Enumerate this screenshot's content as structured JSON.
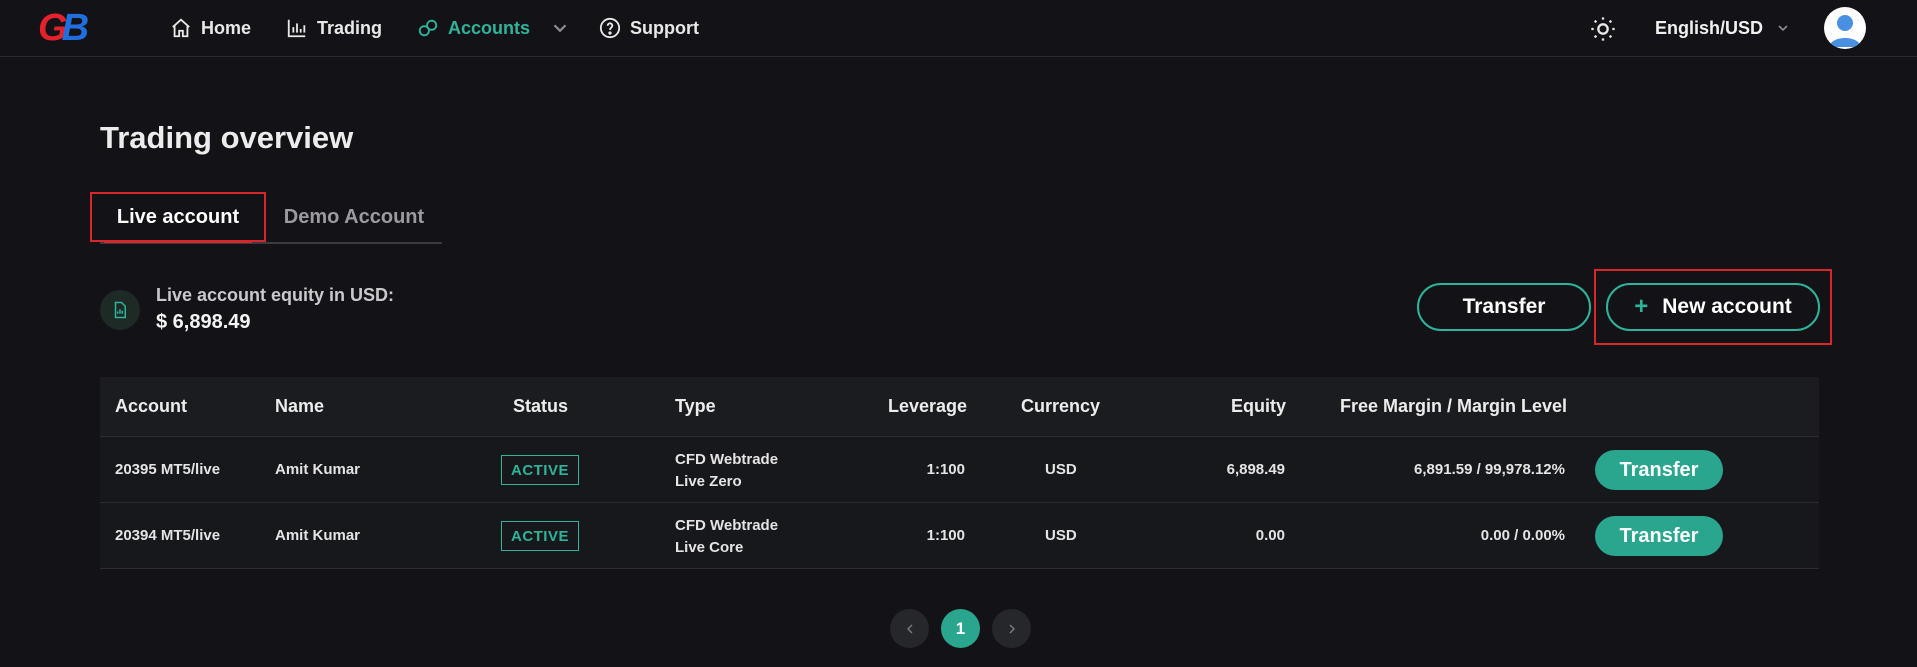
{
  "nav": {
    "logo_text_1": "G",
    "logo_text_2": "B",
    "items": [
      {
        "label": "Home",
        "icon": "home-icon"
      },
      {
        "label": "Trading",
        "icon": "chart-bar-icon"
      },
      {
        "label": "Accounts",
        "icon": "link-icon",
        "active": true
      },
      {
        "label": "Support",
        "icon": "help-circle-icon"
      }
    ],
    "language": "English/USD"
  },
  "page": {
    "title": "Trading overview",
    "tabs": [
      "Live account",
      "Demo Account"
    ],
    "equity_label": "Live account equity in USD:",
    "equity_value": "$ 6,898.49",
    "transfer_label": "Transfer",
    "new_account_label": "New account",
    "new_account_plus": "+"
  },
  "table": {
    "headers": [
      "Account",
      "Name",
      "Status",
      "Type",
      "Leverage",
      "Currency",
      "Equity",
      "Free Margin / Margin Level"
    ],
    "rows": [
      {
        "account": "20395 MT5/live",
        "name": "Amit Kumar",
        "status": "ACTIVE",
        "type_line1": "CFD Webtrade",
        "type_line2": "Live Zero",
        "leverage": "1:100",
        "currency": "USD",
        "equity": "6,898.49",
        "margin": "6,891.59 / 99,978.12%",
        "action": "Transfer"
      },
      {
        "account": "20394 MT5/live",
        "name": "Amit Kumar",
        "status": "ACTIVE",
        "type_line1": "CFD Webtrade",
        "type_line2": "Live Core",
        "leverage": "1:100",
        "currency": "USD",
        "equity": "0.00",
        "margin": "0.00 / 0.00%",
        "action": "Transfer"
      }
    ]
  },
  "pagination": {
    "current_page": "1"
  },
  "colors": {
    "accent": "#2fb39a",
    "highlight": "#d9262b",
    "background": "#131317"
  }
}
